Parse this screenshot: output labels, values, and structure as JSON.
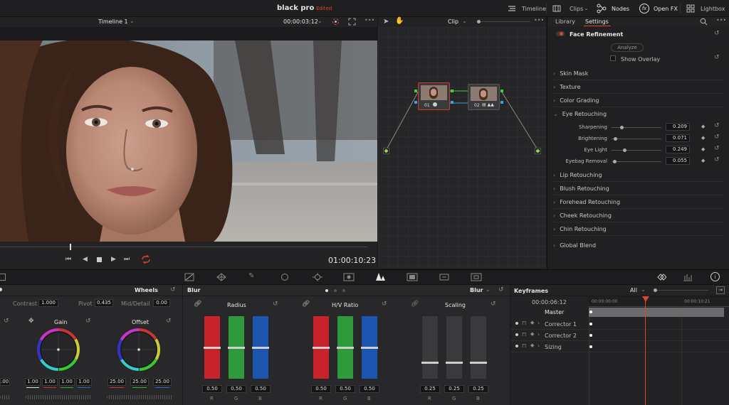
{
  "topbar": {
    "project": "black pro",
    "status": "Edited",
    "timeline": "Timeline",
    "clips": "Clips",
    "nodes": "Nodes",
    "openfx": "Open FX",
    "lightbox": "Lightbox",
    "status_color": "#e0442a"
  },
  "viewer": {
    "timeline_name": "Timeline 1",
    "timecode": "00:00:03:12",
    "current_tc": "01:00:10:23"
  },
  "nodes": {
    "mode": "Clip",
    "node1_label": "01",
    "node2_label": "02"
  },
  "right": {
    "tab_library": "Library",
    "tab_settings": "Settings",
    "title": "Face Refinement",
    "analyze": "Analyze",
    "show_overlay": "Show Overlay",
    "sections_before": [
      "Skin Mask",
      "Texture",
      "Color Grading"
    ],
    "eye_section": "Eye Retouching",
    "eye_sliders": [
      {
        "label": "Sharpening",
        "value": "0.209",
        "pos": 0.2
      },
      {
        "label": "Brightening",
        "value": "0.071",
        "pos": 0.07
      },
      {
        "label": "Eye Light",
        "value": "0.249",
        "pos": 0.25
      },
      {
        "label": "Eyebag Removal",
        "value": "0.055",
        "pos": 0.055
      }
    ],
    "sections_after": [
      "Lip Retouching",
      "Blush Retouching",
      "Forehead Retouching",
      "Cheek Retouching",
      "Chin Retouching"
    ],
    "global_blend": "Global Blend"
  },
  "wheels": {
    "mode": "Wheels",
    "contrast_label": "Contrast",
    "contrast": "1.000",
    "pivot_label": "Pivot",
    "pivot": "0.435",
    "middetail_label": "Mid/Detail",
    "middetail": "0.00",
    "gain_label": "Gain",
    "offset_label": "Offset",
    "left_partial": ".00",
    "gain_values": [
      "1.00",
      "1.00",
      "1.00",
      "1.00"
    ],
    "offset_values": [
      "25.00",
      "25.00",
      "25.00"
    ]
  },
  "blur": {
    "title": "Blur",
    "mode": "Blur",
    "radius_label": "Radius",
    "hv_label": "H/V Ratio",
    "scaling_label": "Scaling",
    "radius": [
      {
        "ch": "R",
        "v": "0.50",
        "level": 0.5
      },
      {
        "ch": "G",
        "v": "0.50",
        "level": 0.5
      },
      {
        "ch": "B",
        "v": "0.50",
        "level": 0.5
      }
    ],
    "hv": [
      {
        "ch": "R",
        "v": "0.50",
        "level": 0.5
      },
      {
        "ch": "G",
        "v": "0.50",
        "level": 0.5
      },
      {
        "ch": "B",
        "v": "0.50",
        "level": 0.5
      }
    ],
    "scaling": [
      {
        "ch": "R",
        "v": "0.25",
        "level": 0.25
      },
      {
        "ch": "G",
        "v": "0.25",
        "level": 0.25
      },
      {
        "ch": "B",
        "v": "0.25",
        "level": 0.25
      }
    ]
  },
  "keyframes": {
    "title": "Keyframes",
    "filter": "All",
    "tc": "00:00:06:12",
    "ruler_start": "00:00:00:00",
    "ruler_end": "00:00:10:21",
    "master": "Master",
    "rows": [
      "Corrector 1",
      "Corrector 2",
      "Sizing"
    ]
  },
  "colors": {
    "accent_red": "#e0442a",
    "bar_red": "#c8232a",
    "bar_green": "#2f9a3a",
    "bar_blue": "#1d56b0",
    "bar_gray": "#3a3a3c"
  }
}
